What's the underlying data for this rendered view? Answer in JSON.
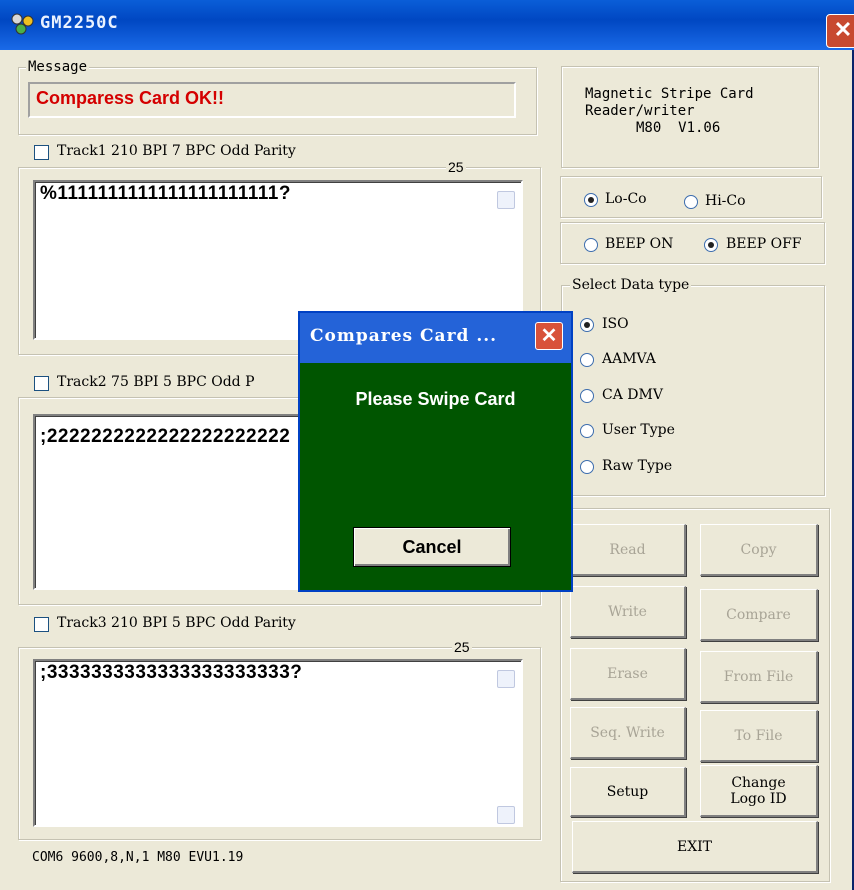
{
  "window": {
    "title": "GM2250C"
  },
  "message": {
    "legend": "Message",
    "text": "Comparess Card OK!!"
  },
  "info": {
    "line1": "Magnetic Stripe Card",
    "line2": "Reader/writer",
    "line3": "M80  V1.06"
  },
  "tracks": [
    {
      "label": "Track1 210 BPI 7 BPC Odd Parity",
      "count": "25",
      "data": "%1111111111111111111111?"
    },
    {
      "label": "Track2 75 BPI 5 BPC Odd P",
      "count": "",
      "data": ";2222222222222222222222"
    },
    {
      "label": "Track3 210 BPI 5 BPC Odd Parity",
      "count": "25",
      "data": ";3333333333333333333333?"
    }
  ],
  "coercivity": {
    "lo": "Lo-Co",
    "hi": "Hi-Co",
    "selected": "lo"
  },
  "beep": {
    "on": "BEEP ON",
    "off": "BEEP OFF",
    "selected": "off"
  },
  "datatype": {
    "legend": "Select Data type",
    "options": [
      "ISO",
      "AAMVA",
      "CA DMV",
      "User Type",
      "Raw Type"
    ],
    "selected": "ISO"
  },
  "buttons": {
    "read": "Read",
    "copy": "Copy",
    "write": "Write",
    "compare": "Compare",
    "erase": "Erase",
    "from_file": "From File",
    "seq_write": "Seq. Write",
    "to_file": "To File",
    "setup": "Setup",
    "change_logo_1": "Change",
    "change_logo_2": "Logo ID",
    "exit": "EXIT"
  },
  "status": "COM6 9600,8,N,1  M80 EVU1.19",
  "dialog": {
    "title": "Compares Card ...",
    "message": "Please Swipe Card",
    "cancel": "Cancel"
  },
  "colors": {
    "title_bar": "#0047c2",
    "message_text": "#d40000",
    "dialog_bg": "#005500"
  }
}
